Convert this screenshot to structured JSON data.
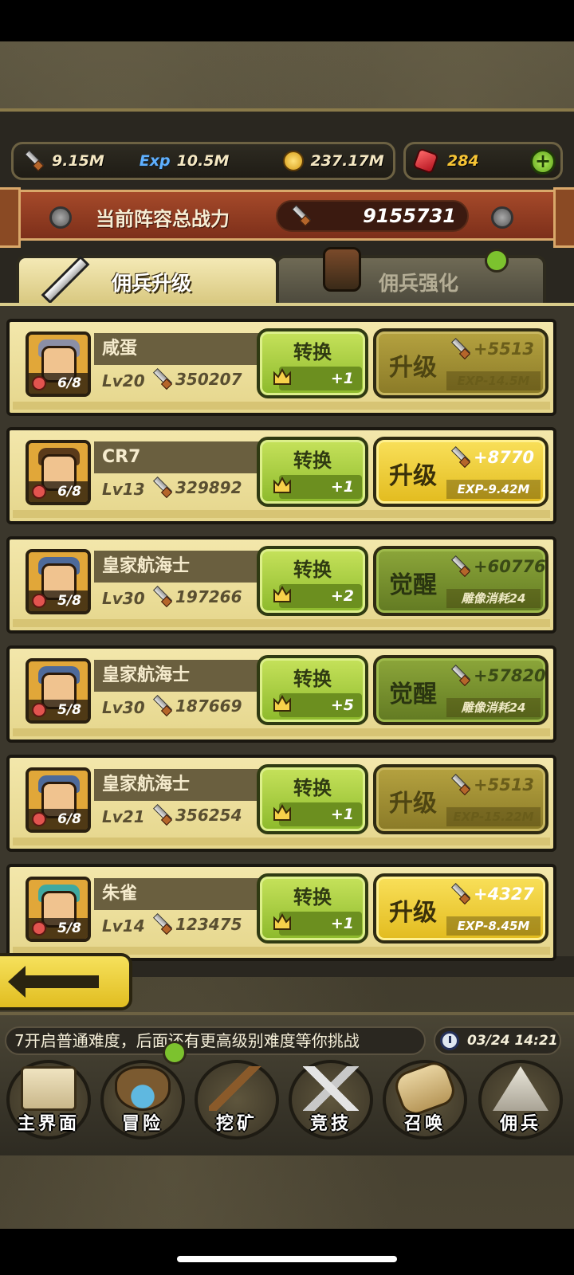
{
  "resources": {
    "power": "9.15M",
    "exp": "10.5M",
    "gold": "237.17M",
    "gems": "284",
    "exp_icon_text": "Exp"
  },
  "team_power": {
    "title": "当前阵容总战力",
    "value": "9155731"
  },
  "tabs": [
    {
      "label": "佣兵升级",
      "active": true
    },
    {
      "label": "佣兵强化",
      "active": false
    }
  ],
  "mercenaries": [
    {
      "name": "咸蛋",
      "level": "Lv20",
      "power": "350207",
      "stars": "6/8",
      "convert_label": "转换",
      "convert_cost": "+1",
      "action_label": "升级",
      "action_gain": "+5513",
      "action_sub": "EXP-14.5M",
      "action_state": "disabled"
    },
    {
      "name": "CR7",
      "level": "Lv13",
      "power": "329892",
      "stars": "6/8",
      "convert_label": "转换",
      "convert_cost": "+1",
      "action_label": "升级",
      "action_gain": "+8770",
      "action_sub": "EXP-9.42M",
      "action_state": "active"
    },
    {
      "name": "皇家航海士",
      "level": "Lv30",
      "power": "197266",
      "stars": "5/8",
      "convert_label": "转换",
      "convert_cost": "+2",
      "action_label": "觉醒",
      "action_gain": "+60776",
      "action_sub": "雕像消耗24",
      "action_state": "awaken"
    },
    {
      "name": "皇家航海士",
      "level": "Lv30",
      "power": "187669",
      "stars": "5/8",
      "convert_label": "转换",
      "convert_cost": "+5",
      "action_label": "觉醒",
      "action_gain": "+57820",
      "action_sub": "雕像消耗24",
      "action_state": "awaken"
    },
    {
      "name": "皇家航海士",
      "level": "Lv21",
      "power": "356254",
      "stars": "6/8",
      "convert_label": "转换",
      "convert_cost": "+1",
      "action_label": "升级",
      "action_gain": "+5513",
      "action_sub": "EXP-15.22M",
      "action_state": "disabled"
    },
    {
      "name": "朱雀",
      "level": "Lv14",
      "power": "123475",
      "stars": "5/8",
      "convert_label": "转换",
      "convert_cost": "+1",
      "action_label": "升级",
      "action_gain": "+4327",
      "action_sub": "EXP-8.45M",
      "action_state": "active"
    }
  ],
  "ticker": {
    "message": "7开启普通难度，后面还有更高级别难度等你挑战",
    "time": "03/24 14:21"
  },
  "nav": [
    {
      "label": "主界面",
      "icon": "map-scroll-icon"
    },
    {
      "label": "冒险",
      "icon": "floating-island-icon"
    },
    {
      "label": "挖矿",
      "icon": "pickaxe-icon"
    },
    {
      "label": "竞技",
      "icon": "crossed-swords-icon"
    },
    {
      "label": "召唤",
      "icon": "scroll-icon"
    },
    {
      "label": "佣兵",
      "icon": "tent-icon"
    }
  ],
  "colors": {
    "green_button": "#8cb92b",
    "yellow_button": "#e2bb1e",
    "banner_red": "#a54a2a",
    "panel_cream": "#f3e7ab"
  }
}
